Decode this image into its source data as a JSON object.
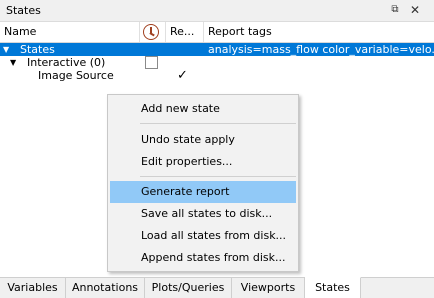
{
  "panel": {
    "title": "States",
    "float_icon": "float-window-icon",
    "close_icon": "close-icon"
  },
  "header": {
    "name": "Name",
    "clock_icon": "clock-icon",
    "re": "Re...",
    "tags": "Report tags"
  },
  "tree": {
    "states": {
      "label": "States",
      "tags": "analysis=mass_flow color_variable=velo..."
    },
    "interactive": {
      "label": "Interactive (0)"
    },
    "image_source": {
      "label": "Image Source",
      "checked": "✓"
    }
  },
  "context_menu": {
    "items": [
      "Add new state",
      "Undo state apply",
      "Edit properties...",
      "Generate report",
      "Save all states to disk...",
      "Load all states from disk...",
      "Append states from disk..."
    ],
    "highlighted": "Generate report"
  },
  "tabs": [
    "Variables",
    "Annotations",
    "Plots/Queries",
    "Viewports",
    "States"
  ],
  "active_tab": "States",
  "colors": {
    "selection": "#0078d7",
    "menu_highlight": "#91c9f7"
  }
}
